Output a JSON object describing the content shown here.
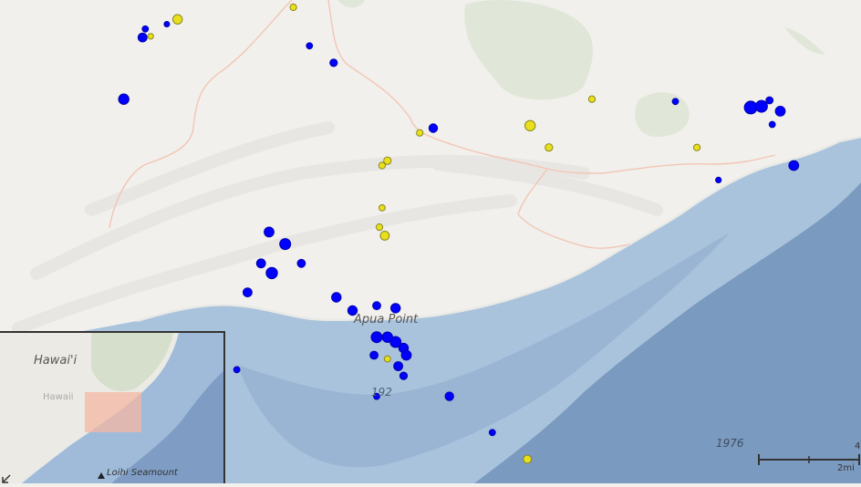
{
  "map": {
    "labels": {
      "apua_point": "Apua Point",
      "depth_192": "192",
      "depth_1976": "1976"
    },
    "colors": {
      "land": "#f1f0ec",
      "vegetation": "#dfe5d6",
      "ocean_shallow": "#a9c3dc",
      "ocean_deep": "#7b9ac0",
      "road": "#f2c6b4",
      "quake_deep": "#0000ff",
      "quake_shallow": "#e8e01a"
    },
    "earthquakes": {
      "blue": [
        {
          "lon": -155.346,
          "lat": 19.328,
          "mag": 1.6
        },
        {
          "lon": -155.338,
          "lat": 19.33,
          "mag": 1.4
        },
        {
          "lon": -155.347,
          "lat": 19.3245,
          "mag": 2.2
        },
        {
          "lon": -155.354,
          "lat": 19.299,
          "mag": 2.5
        },
        {
          "lon": -155.285,
          "lat": 19.321,
          "mag": 1.6
        },
        {
          "lon": -155.276,
          "lat": 19.314,
          "mag": 1.9
        },
        {
          "lon": -155.239,
          "lat": 19.287,
          "mag": 2.1
        },
        {
          "lon": -155.3,
          "lat": 19.244,
          "mag": 2.4
        },
        {
          "lon": -155.294,
          "lat": 19.239,
          "mag": 2.6
        },
        {
          "lon": -155.288,
          "lat": 19.231,
          "mag": 2.0
        },
        {
          "lon": -155.303,
          "lat": 19.231,
          "mag": 2.2
        },
        {
          "lon": -155.299,
          "lat": 19.227,
          "mag": 2.7
        },
        {
          "lon": -155.308,
          "lat": 19.219,
          "mag": 2.2
        },
        {
          "lon": -155.275,
          "lat": 19.217,
          "mag": 2.3
        },
        {
          "lon": -155.26,
          "lat": 19.2135,
          "mag": 2.0
        },
        {
          "lon": -155.269,
          "lat": 19.2115,
          "mag": 2.3
        },
        {
          "lon": -155.253,
          "lat": 19.2125,
          "mag": 2.3
        },
        {
          "lon": -155.26,
          "lat": 19.2005,
          "mag": 2.6
        },
        {
          "lon": -155.253,
          "lat": 19.1985,
          "mag": 2.6
        },
        {
          "lon": -155.256,
          "lat": 19.2005,
          "mag": 2.5
        },
        {
          "lon": -155.25,
          "lat": 19.196,
          "mag": 2.3
        },
        {
          "lon": -155.261,
          "lat": 19.193,
          "mag": 2.0
        },
        {
          "lon": -155.249,
          "lat": 19.193,
          "mag": 2.4
        },
        {
          "lon": -155.252,
          "lat": 19.1885,
          "mag": 2.2
        },
        {
          "lon": -155.25,
          "lat": 19.1845,
          "mag": 1.9
        },
        {
          "lon": -155.312,
          "lat": 19.187,
          "mag": 1.6
        },
        {
          "lon": -155.26,
          "lat": 19.176,
          "mag": 1.6
        },
        {
          "lon": -155.233,
          "lat": 19.176,
          "mag": 2.1
        },
        {
          "lon": -155.217,
          "lat": 19.161,
          "mag": 1.6
        },
        {
          "lon": -155.149,
          "lat": 19.298,
          "mag": 1.6
        },
        {
          "lon": -155.121,
          "lat": 19.2955,
          "mag": 3.0
        },
        {
          "lon": -155.117,
          "lat": 19.296,
          "mag": 2.8
        },
        {
          "lon": -155.114,
          "lat": 19.2985,
          "mag": 1.8
        },
        {
          "lon": -155.11,
          "lat": 19.294,
          "mag": 2.4
        },
        {
          "lon": -155.113,
          "lat": 19.2885,
          "mag": 1.6
        },
        {
          "lon": -155.105,
          "lat": 19.2715,
          "mag": 2.4
        },
        {
          "lon": -155.133,
          "lat": 19.2655,
          "mag": 1.5
        }
      ],
      "yellow": [
        {
          "lon": -155.334,
          "lat": 19.332,
          "mag": 2.3
        },
        {
          "lon": -155.344,
          "lat": 19.325,
          "mag": 1.5
        },
        {
          "lon": -155.291,
          "lat": 19.337,
          "mag": 1.7
        },
        {
          "lon": -155.244,
          "lat": 19.285,
          "mag": 1.7
        },
        {
          "lon": -155.256,
          "lat": 19.2735,
          "mag": 1.9
        },
        {
          "lon": -155.258,
          "lat": 19.2715,
          "mag": 1.7
        },
        {
          "lon": -155.258,
          "lat": 19.254,
          "mag": 1.6
        },
        {
          "lon": -155.259,
          "lat": 19.246,
          "mag": 1.7
        },
        {
          "lon": -155.257,
          "lat": 19.2425,
          "mag": 2.2
        },
        {
          "lon": -155.256,
          "lat": 19.1915,
          "mag": 1.6
        },
        {
          "lon": -155.18,
          "lat": 19.299,
          "mag": 1.7
        },
        {
          "lon": -155.203,
          "lat": 19.288,
          "mag": 2.5
        },
        {
          "lon": -155.196,
          "lat": 19.279,
          "mag": 1.9
        },
        {
          "lon": -155.141,
          "lat": 19.279,
          "mag": 1.7
        },
        {
          "lon": -155.204,
          "lat": 19.15,
          "mag": 2.0
        }
      ]
    },
    "scale_bar": {
      "label": "2mi",
      "label_right": "4"
    }
  },
  "overview": {
    "labels": {
      "hawaii_large": "Hawai'i",
      "hawaii_small": "Hawaii",
      "loihi": "Loihi Seamount"
    },
    "extent_box_color": "#f3b7a3",
    "loihi_marker": "triangle-icon",
    "collapse_icon": "collapse-arrow-icon"
  }
}
